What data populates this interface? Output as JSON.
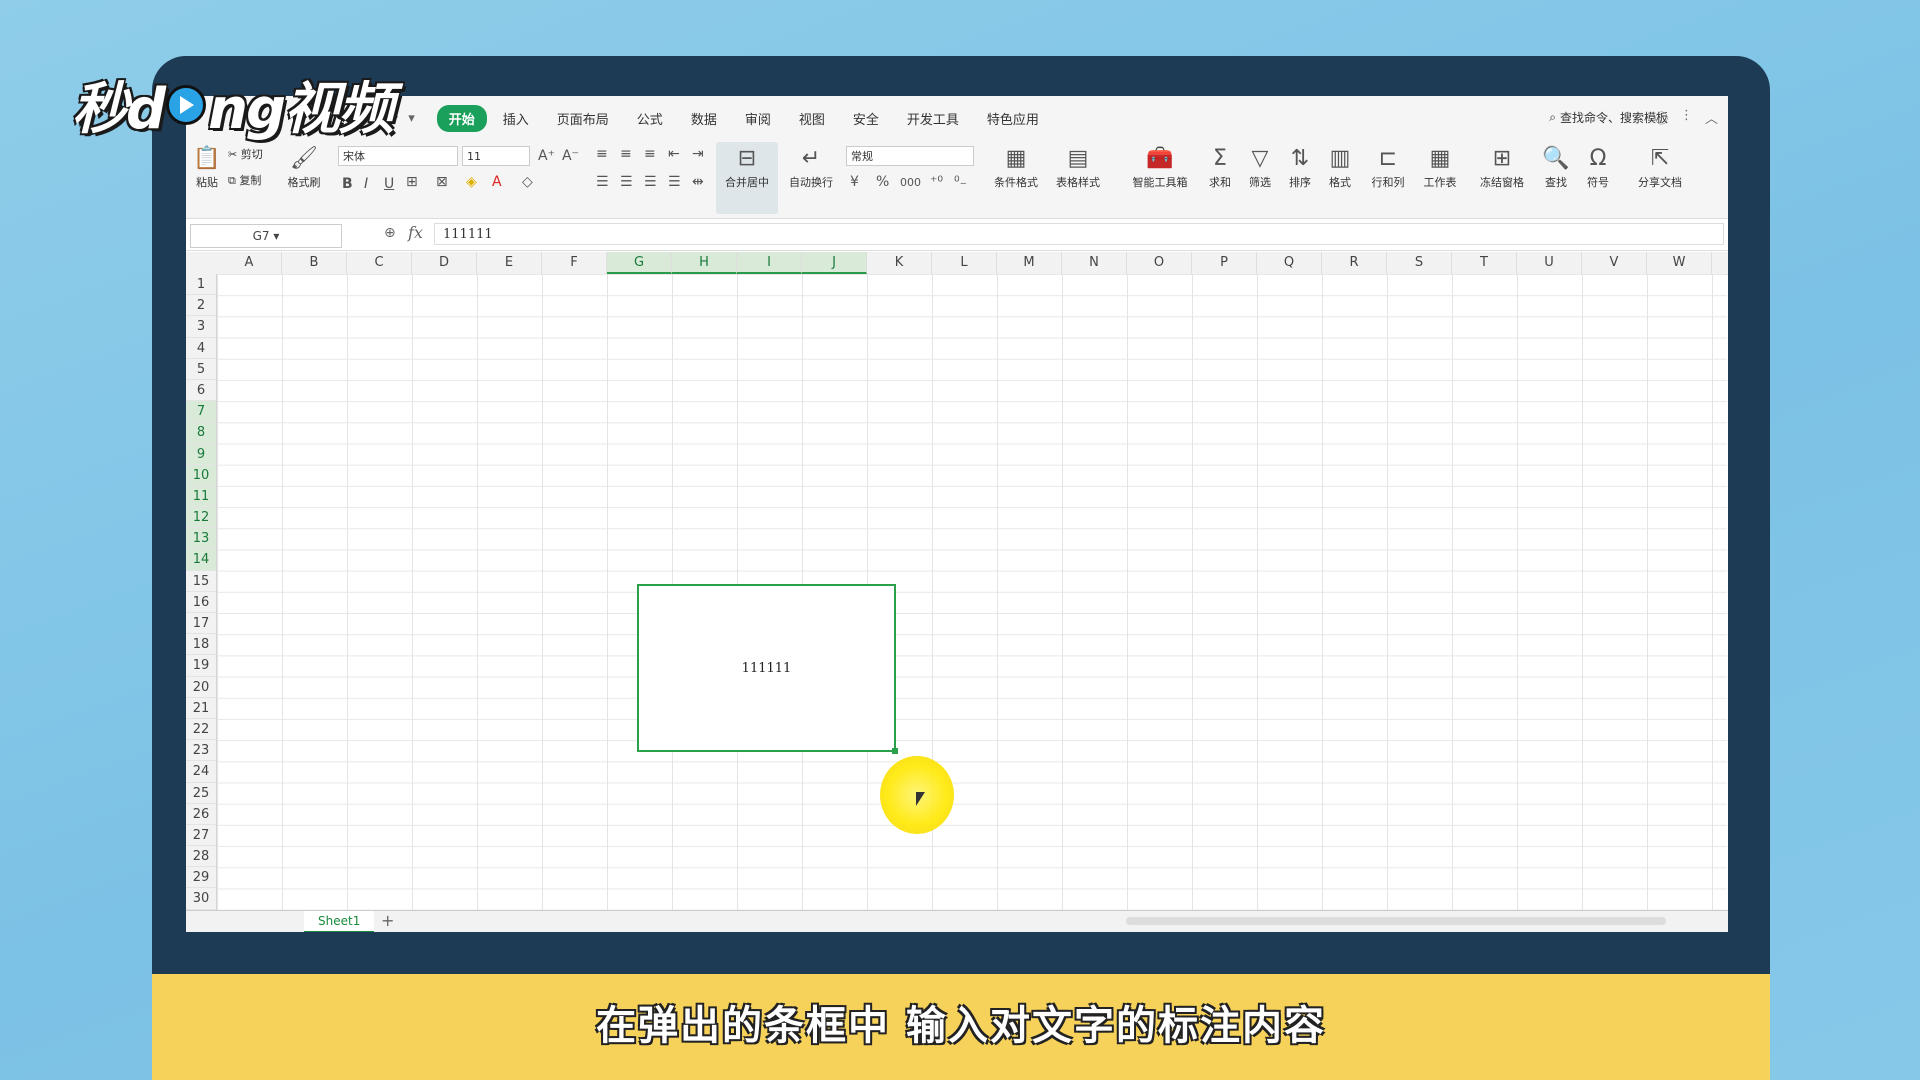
{
  "logo": {
    "text_left": "秒d",
    "text_right": "ng视频"
  },
  "menu": {
    "tabs": [
      "开始",
      "插入",
      "页面布局",
      "公式",
      "数据",
      "审阅",
      "视图",
      "安全",
      "开发工具",
      "特色应用"
    ],
    "active_tab": "开始",
    "search_placeholder": "查找命令、搜索模板"
  },
  "ribbon": {
    "paste": "粘贴",
    "cut": "剪切",
    "copy": "复制",
    "format_painter": "格式刷",
    "font_name": "宋体",
    "font_size": "11",
    "merge_center": "合并居中",
    "wrap_text": "自动换行",
    "number_format": "常规",
    "conditional_format": "条件格式",
    "table_style": "表格样式",
    "smart_toolbox": "智能工具箱",
    "sum": "求和",
    "filter": "筛选",
    "sort": "排序",
    "format": "格式",
    "rows_cols": "行和列",
    "worksheet": "工作表",
    "freeze": "冻结窗格",
    "find": "查找",
    "symbol": "符号",
    "share": "分享文档"
  },
  "formula_bar": {
    "name_box": "G7",
    "fx": "fx",
    "value": "111111"
  },
  "columns": [
    "A",
    "B",
    "C",
    "D",
    "E",
    "F",
    "G",
    "H",
    "I",
    "J",
    "K",
    "L",
    "M",
    "N",
    "O",
    "P",
    "Q",
    "R",
    "S",
    "T",
    "U",
    "V",
    "W"
  ],
  "selected_columns": [
    "G",
    "H",
    "I",
    "J"
  ],
  "rows": [
    "1",
    "2",
    "3",
    "4",
    "5",
    "6",
    "7",
    "8",
    "9",
    "10",
    "11",
    "12",
    "13",
    "14",
    "15",
    "16",
    "17",
    "18",
    "19",
    "20",
    "21",
    "22",
    "23",
    "24",
    "25",
    "26",
    "27",
    "28",
    "29",
    "30"
  ],
  "selected_rows": [
    "7",
    "8",
    "9",
    "10",
    "11",
    "12",
    "13",
    "14"
  ],
  "merged_cell": {
    "value": "111111"
  },
  "sheet": {
    "tab": "Sheet1",
    "add": "+"
  },
  "caption": "在弹出的条框中 输入对文字的标注内容",
  "colors": {
    "accent_green": "#1aa05a",
    "caption_bg": "#f7d25a",
    "monitor": "#1d3b55"
  }
}
